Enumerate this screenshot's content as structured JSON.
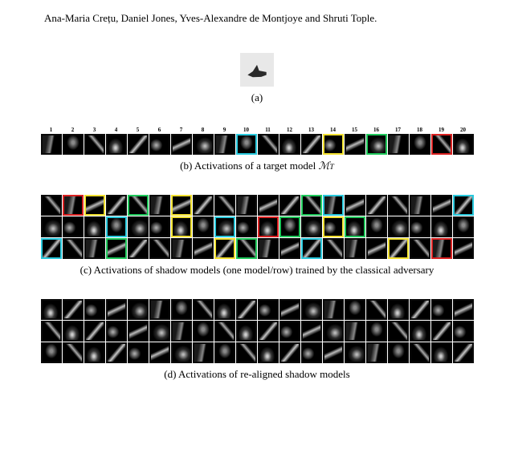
{
  "authors": "Ana-Maria Crețu, Daniel Jones, Yves-Alexandre de Montjoye and Shruti Tople.",
  "caption_a": "(a)",
  "caption_b_prefix": "(b)  Activations of a target model ",
  "caption_b_model": "ℳ",
  "caption_b_sub": "T",
  "caption_c": "(c)  Activations of shadow models (one model/row) trained by the classical adversary",
  "caption_d": "(d)  Activations of re-aligned shadow models",
  "strip_b": {
    "count": 20,
    "highlights": {
      "10": "cyan",
      "14": "yellow",
      "16": "green",
      "19": "red"
    }
  },
  "strip_c": {
    "rows": 3,
    "cols": 20,
    "highlights": [
      {
        "2": "red",
        "3": "yellow",
        "5": "green",
        "7": "yellow",
        "13": "green",
        "14": "cyan",
        "20": "cyan"
      },
      {
        "4": "cyan",
        "7": "yellow",
        "9": "cyan",
        "11": "red",
        "12": "green",
        "14": "yellow",
        "15": "green"
      },
      {
        "1": "cyan",
        "4": "green",
        "9": "yellow",
        "10": "green",
        "13": "cyan",
        "17": "yellow",
        "19": "red"
      }
    ]
  },
  "strip_d": {
    "rows": 3,
    "cols": 20
  }
}
